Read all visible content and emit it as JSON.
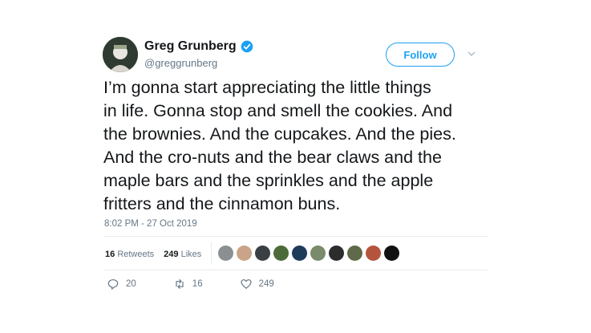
{
  "tweet": {
    "author": {
      "display_name": "Greg Grunberg",
      "handle": "@greggrunberg",
      "verified_icon": "verified-badge-icon",
      "avatar_icon": "avatar"
    },
    "follow_label": "Follow",
    "text": "I’m gonna start appreciating the little things\nin life. Gonna stop and smell the cookies. And\nthe brownies. And the cupcakes. And the pies.\nAnd the cro-nuts and the bear claws and the\nmaple bars and the sprinkles and the apple\nfritters and the cinnamon buns.",
    "timestamp": "8:02 PM - 27 Oct 2019",
    "stats": {
      "retweets_count": "16",
      "retweets_label": "Retweets",
      "likes_count": "249",
      "likes_label": "Likes"
    },
    "likers": [
      {
        "color": "#8a8f92"
      },
      {
        "color": "#c9a488"
      },
      {
        "color": "#3a3f45"
      },
      {
        "color": "#4c6b3a"
      },
      {
        "color": "#1f3b5a"
      },
      {
        "color": "#7a8a6c"
      },
      {
        "color": "#2c2c2c"
      },
      {
        "color": "#5e6a4a"
      },
      {
        "color": "#b5543c"
      },
      {
        "color": "#111111"
      }
    ],
    "actions": {
      "reply_count": "20",
      "retweet_count": "16",
      "like_count": "249"
    },
    "colors": {
      "accent": "#1da1f2",
      "muted": "#657786"
    }
  }
}
